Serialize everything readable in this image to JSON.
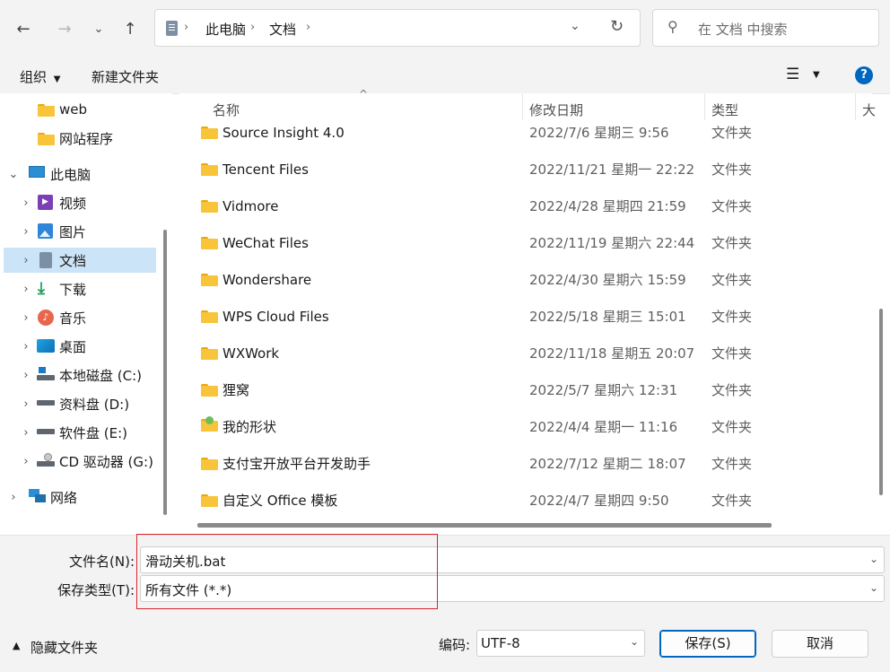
{
  "search": {
    "placeholder": "在 文档 中搜索"
  },
  "address": {
    "crumbs": [
      "此电脑",
      "文档"
    ]
  },
  "toolbar": {
    "organize": "组织",
    "new_folder": "新建文件夹",
    "help": "?"
  },
  "sidebar": {
    "items": [
      {
        "label": "web",
        "icon": "folder-icon"
      },
      {
        "label": "网站程序",
        "icon": "folder-icon"
      },
      {
        "label": "此电脑",
        "icon": "computer-icon"
      },
      {
        "label": "视频",
        "icon": "video-icon"
      },
      {
        "label": "图片",
        "icon": "pictures-icon"
      },
      {
        "label": "文档",
        "icon": "documents-icon"
      },
      {
        "label": "下载",
        "icon": "download-icon"
      },
      {
        "label": "音乐",
        "icon": "music-icon"
      },
      {
        "label": "桌面",
        "icon": "desktop-icon"
      },
      {
        "label": "本地磁盘 (C:)",
        "icon": "drive-icon"
      },
      {
        "label": "资料盘 (D:)",
        "icon": "drive-icon"
      },
      {
        "label": "软件盘 (E:)",
        "icon": "drive-icon"
      },
      {
        "label": "CD 驱动器 (G:)",
        "icon": "cd-drive-icon"
      },
      {
        "label": "网络",
        "icon": "network-icon"
      }
    ]
  },
  "columns": {
    "name": "名称",
    "date": "修改日期",
    "type": "类型",
    "size": "大"
  },
  "files": [
    {
      "name": "Source Insight 4.0",
      "date": "2022/7/6 星期三 9:56",
      "type": "文件夹",
      "icon": "folder-icon"
    },
    {
      "name": "Tencent Files",
      "date": "2022/11/21 星期一 22:22",
      "type": "文件夹",
      "icon": "folder-icon"
    },
    {
      "name": "Vidmore",
      "date": "2022/4/28 星期四 21:59",
      "type": "文件夹",
      "icon": "folder-icon"
    },
    {
      "name": "WeChat Files",
      "date": "2022/11/19 星期六 22:44",
      "type": "文件夹",
      "icon": "folder-icon"
    },
    {
      "name": "Wondershare",
      "date": "2022/4/30 星期六 15:59",
      "type": "文件夹",
      "icon": "folder-icon"
    },
    {
      "name": "WPS Cloud Files",
      "date": "2022/5/18 星期三 15:01",
      "type": "文件夹",
      "icon": "folder-icon"
    },
    {
      "name": "WXWork",
      "date": "2022/11/18 星期五 20:07",
      "type": "文件夹",
      "icon": "folder-icon"
    },
    {
      "name": "狸窝",
      "date": "2022/5/7 星期六 12:31",
      "type": "文件夹",
      "icon": "folder-icon"
    },
    {
      "name": "我的形状",
      "date": "2022/4/4 星期一 11:16",
      "type": "文件夹",
      "icon": "shapes-folder-icon"
    },
    {
      "name": "支付宝开放平台开发助手",
      "date": "2022/7/12 星期二 18:07",
      "type": "文件夹",
      "icon": "folder-icon"
    },
    {
      "name": "自定义 Office 模板",
      "date": "2022/4/7 星期四 9:50",
      "type": "文件夹",
      "icon": "folder-icon"
    }
  ],
  "form": {
    "filename_label": "文件名(N):",
    "filename_value": "滑动关机.bat",
    "filetype_label": "保存类型(T):",
    "filetype_value": "所有文件  (*.*)",
    "hide_folders": "隐藏文件夹",
    "encoding_label": "编码:",
    "encoding_value": "UTF-8",
    "save": "保存(S)",
    "cancel": "取消"
  },
  "colors": {
    "accent": "#0067c0",
    "selected": "#cce4f7",
    "highlight_box": "#d9232a",
    "folder": "#f8c43a"
  }
}
